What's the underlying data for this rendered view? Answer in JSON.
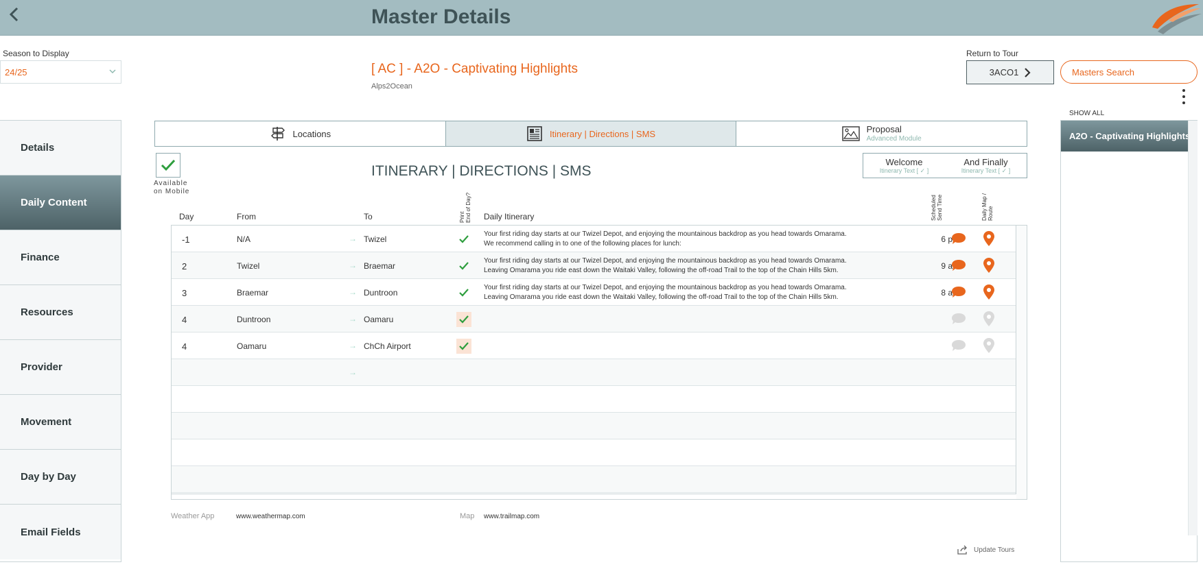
{
  "header": {
    "title": "Master Details"
  },
  "season": {
    "label": "Season to Display",
    "value": "24/25"
  },
  "tour": {
    "title": "[ AC ] - A2O - Captivating Highlights",
    "subtitle": "Alps2Ocean"
  },
  "return_to_tour": {
    "label": "Return to Tour",
    "code": "3ACO1"
  },
  "masters_search": {
    "label": "Masters Search"
  },
  "sidebar": {
    "items": [
      {
        "label": "Details"
      },
      {
        "label": "Daily Content",
        "active": true
      },
      {
        "label": "Finance"
      },
      {
        "label": "Resources"
      },
      {
        "label": "Provider"
      },
      {
        "label": "Movement"
      },
      {
        "label": "Day by Day"
      },
      {
        "label": "Email Fields"
      }
    ]
  },
  "tabs": [
    {
      "label": "Locations",
      "icon": "signpost-icon"
    },
    {
      "label": "Itinerary | Directions | SMS",
      "icon": "document-icon",
      "active": true
    },
    {
      "label": "Proposal",
      "sub": "Advanced Module",
      "icon": "image-icon"
    }
  ],
  "mobile": {
    "label_line1": "Available",
    "label_line2": "on Mobile",
    "checked": true
  },
  "section_title": "ITINERARY | DIRECTIONS | SMS",
  "welcome_finally": [
    {
      "label": "Welcome",
      "sub": "Itinerary Text [ ✓ ]"
    },
    {
      "label": "And Finally",
      "sub": "Itinerary Text [ ✓ ]"
    }
  ],
  "columns": {
    "day": "Day",
    "from": "From",
    "to": "To",
    "print_line1": "Print",
    "print_line2": "End of Day?",
    "itinerary": "Daily Itinerary",
    "send_line1": "Scheduled",
    "send_line2": "Send Time",
    "map_line1": "Daily Map /",
    "map_line2": "Route"
  },
  "rows": [
    {
      "day": "-1",
      "from": "N/A",
      "arrow": "→",
      "to": "Twizel",
      "print": "check",
      "itin1": "Your first riding day starts at our Twizel Depot, and enjoying the mountainous backdrop as you head towards Omarama.",
      "itin2": "We recommend calling in to one of the following places for lunch:",
      "time": "6 pm",
      "active": true
    },
    {
      "day": "2",
      "from": "Twizel",
      "arrow": "→",
      "to": "Braemar",
      "print": "check",
      "itin1": "Your first riding day starts at our Twizel Depot, and enjoying the mountainous backdrop as you head towards Omarama.",
      "itin2": "Leaving Omarama you ride east down the Waitaki Valley, following the off-road Trail to the top of the Chain Hills 5km.",
      "time": "9 am",
      "active": true
    },
    {
      "day": "3",
      "from": "Braemar",
      "arrow": "→",
      "to": "Duntroon",
      "print": "check",
      "itin1": "Your first riding day starts at our Twizel Depot, and enjoying the mountainous backdrop as you head towards Omarama.",
      "itin2": "Leaving Omarama you ride east down the Waitaki Valley, following the off-road Trail to the top of the Chain Hills 5km.",
      "time": "8 am",
      "active": true
    },
    {
      "day": "4",
      "from": "Duntroon",
      "arrow": "→",
      "to": "Oamaru",
      "print": "boxed",
      "itin1": "",
      "itin2": "",
      "time": "",
      "active": false
    },
    {
      "day": "4",
      "from": "Oamaru",
      "arrow": "→",
      "to": "ChCh Airport",
      "print": "boxed",
      "itin1": "",
      "itin2": "",
      "time": "",
      "active": false
    },
    {
      "day": "",
      "from": "",
      "arrow": "→",
      "to": "",
      "print": "none",
      "itin1": "",
      "itin2": "",
      "time": "",
      "active": null
    },
    {
      "day": "",
      "from": "",
      "arrow": "",
      "to": "",
      "print": "none",
      "itin1": "",
      "itin2": "",
      "time": "",
      "active": null
    },
    {
      "day": "",
      "from": "",
      "arrow": "",
      "to": "",
      "print": "none",
      "itin1": "",
      "itin2": "",
      "time": "",
      "active": null
    },
    {
      "day": "",
      "from": "",
      "arrow": "",
      "to": "",
      "print": "none",
      "itin1": "",
      "itin2": "",
      "time": "",
      "active": null
    },
    {
      "day": "",
      "from": "",
      "arrow": "",
      "to": "",
      "print": "none",
      "itin1": "",
      "itin2": "",
      "time": "",
      "active": null
    }
  ],
  "footer": {
    "weather_label": "Weather App",
    "weather_value": "www.weathermap.com",
    "map_label": "Map",
    "map_value": "www.trailmap.com",
    "update_label": "Update Tours"
  },
  "right_panel": {
    "show_all": "SHOW ALL",
    "items": [
      {
        "label": "A2O - Captivating Highlights"
      }
    ]
  },
  "colors": {
    "accent": "#e8661d",
    "header_bg": "#a3bcc1",
    "active_bg": "#5f767b",
    "check": "#2e9e3e",
    "inactive_icon": "#d9d9d9"
  }
}
